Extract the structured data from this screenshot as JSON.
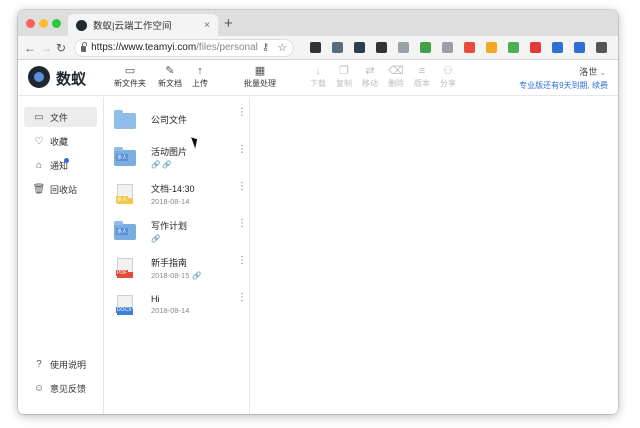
{
  "browser": {
    "tab_title": "数蚁|云端工作空间",
    "tab_close": "×",
    "new_tab": "+",
    "nav_back": "←",
    "nav_forward": "→",
    "nav_reload": "↻",
    "url_host": "https://www.teamyi.com",
    "url_path": "/files/personal",
    "key_icon_glyph": "⚷",
    "star_icon_glyph": "☆",
    "extension_colors": [
      "#333333",
      "#5b6b80",
      "#2c3e50",
      "#333333",
      "#9aa0a6",
      "#43a047",
      "#9aa0a6",
      "#e74c3c",
      "#f5a623",
      "#4caf50",
      "#e53935",
      "#2f6fd6",
      "#2f6fd6",
      "#555555"
    ]
  },
  "header": {
    "brand": "数蚁",
    "tools": [
      {
        "label": "新文件夹",
        "icon": "▭",
        "disabled": false
      },
      {
        "label": "新文档",
        "icon": "✎",
        "disabled": false
      },
      {
        "label": "上传",
        "icon": "↑",
        "disabled": false
      },
      {
        "label": "批量处理",
        "icon": "▦",
        "disabled": false
      },
      {
        "label": "下载",
        "icon": "↓",
        "disabled": true
      },
      {
        "label": "复制",
        "icon": "❐",
        "disabled": true
      },
      {
        "label": "移动",
        "icon": "⇄",
        "disabled": true
      },
      {
        "label": "删除",
        "icon": "⌫",
        "disabled": true
      },
      {
        "label": "版本",
        "icon": "≡",
        "disabled": true
      },
      {
        "label": "分享",
        "icon": "⚇",
        "disabled": true
      }
    ],
    "user_name": "洛世",
    "user_caret": "⌄",
    "trial_text": "专业版还有9天到期, 续费"
  },
  "sidebar": {
    "items": [
      {
        "label": "文件",
        "icon": "▭"
      },
      {
        "label": "收藏",
        "icon": "♡"
      },
      {
        "label": "通知",
        "icon": "⌂"
      },
      {
        "label": "回收站",
        "icon": "🗑"
      }
    ],
    "bottom": [
      {
        "label": "使用说明",
        "icon": "?"
      },
      {
        "label": "意见反馈",
        "icon": "☺"
      }
    ]
  },
  "files": [
    {
      "name": "公司文件",
      "meta": "",
      "link": "",
      "kind": "folder"
    },
    {
      "name": "活动图片",
      "meta": "",
      "link": "🔗 🔗",
      "kind": "shared-folder",
      "tag": "多人"
    },
    {
      "name": "文档-14:30",
      "meta": "2018-08-14",
      "link": "",
      "kind": "doc",
      "band": "#f1c84b",
      "tag": "多人"
    },
    {
      "name": "写作计划",
      "meta": "",
      "link": "🔗",
      "kind": "shared-folder",
      "tag": "多人"
    },
    {
      "name": "新手指南",
      "meta": "2018-08-15",
      "link": "🔗",
      "kind": "pdf",
      "band": "#e34b3b",
      "tag": "PDF"
    },
    {
      "name": "Hi",
      "meta": "2018-08-14",
      "link": "",
      "kind": "doc",
      "band": "#3f7fd6",
      "tag": "DOCX"
    }
  ],
  "more_glyph": "⋮"
}
